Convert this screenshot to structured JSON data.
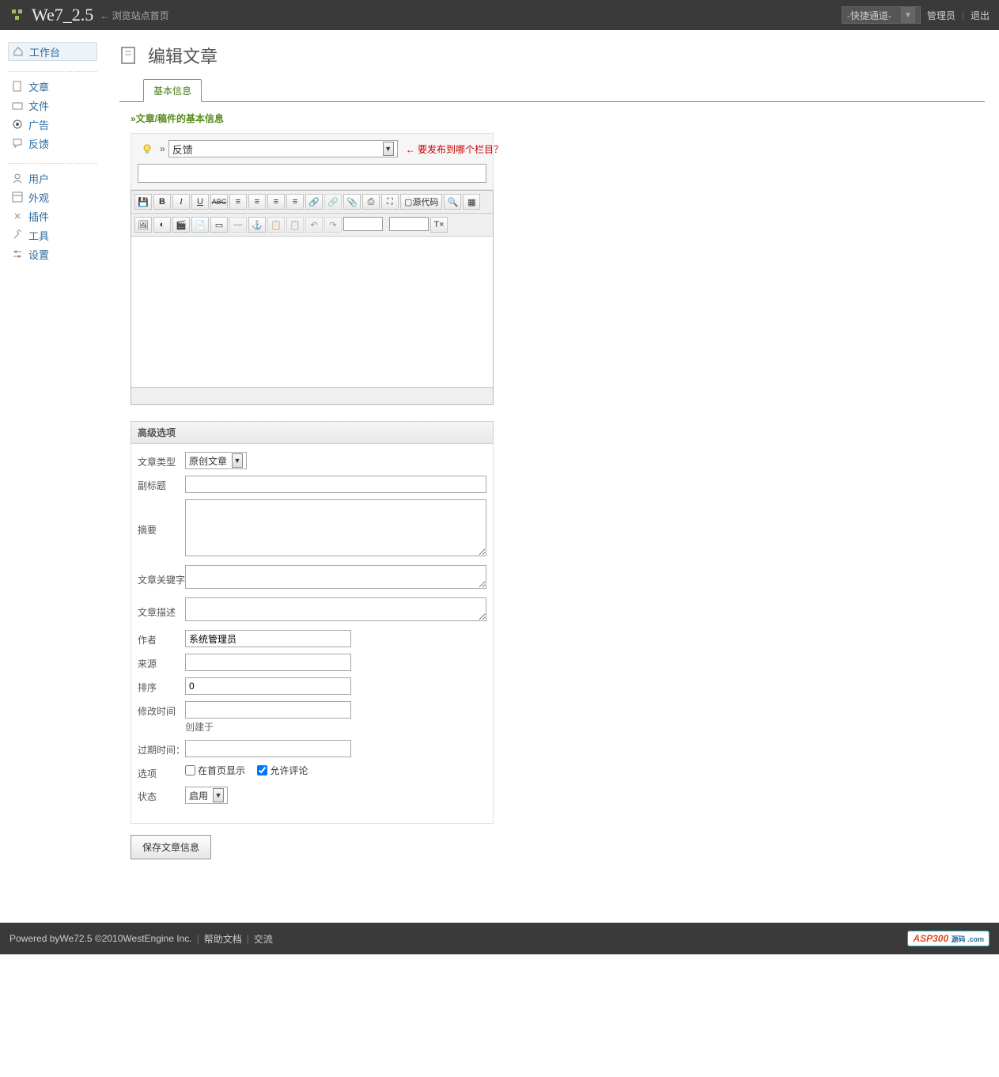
{
  "topbar": {
    "brand": "We7_2.5",
    "brand_sub": "← 浏览站点首页",
    "quick_nav": "-快捷通道-",
    "admin_link": "管理员",
    "logout_link": "退出"
  },
  "sidebar": {
    "workbench": "工作台",
    "article": "文章",
    "file": "文件",
    "ad": "广告",
    "feedback": "反馈",
    "user": "用户",
    "appearance": "外观",
    "plugin": "插件",
    "tool": "工具",
    "setting": "设置"
  },
  "page": {
    "title": "编辑文章",
    "tab_basic": "基本信息",
    "section_title": "»文章/稿件的基本信息"
  },
  "basic": {
    "category_value": "反馈",
    "category_hint": "← 要发布到哪个栏目？",
    "title_value": ""
  },
  "editor": {
    "source_label": "源代码",
    "row1": {
      "save": "💾",
      "bold": "B",
      "italic": "I",
      "underline": "U",
      "strike": "ABC",
      "align_left": "≡",
      "align_center": "≡",
      "align_right": "≡",
      "align_justify": "≡",
      "link": "🔗",
      "unlink": "🔗",
      "attach": "📎",
      "pagebreak": "⎙",
      "fullscreen": "⛶",
      "preview": "🔍",
      "blocks": "▦"
    },
    "row2": {
      "image": "🖼",
      "flash": "◐",
      "video": "🎬",
      "word": "📄",
      "template": "▭",
      "hr": "—",
      "anchor": "⚓",
      "copy": "📋",
      "paste": "📋",
      "undo": "↶",
      "redo": "↷",
      "clear": "T×"
    }
  },
  "adv": {
    "header": "高级选项",
    "labels": {
      "type": "文章类型",
      "subtitle": "副标题",
      "summary": "摘要",
      "keywords": "文章关键字",
      "description": "文章描述",
      "author": "作者",
      "source": "来源",
      "order": "排序",
      "mtime": "修改时间",
      "expire": "过期时间：",
      "options": "选项",
      "status": "状态"
    },
    "values": {
      "type": "原创文章",
      "subtitle": "",
      "summary": "",
      "keywords": "",
      "description": "",
      "author": "系统管理员",
      "source": "",
      "order": "0",
      "mtime": "",
      "mtime_created": "创建于",
      "expire": "",
      "opt_show_home": "在首页显示",
      "opt_allow_comment": "允许评论",
      "status": "启用"
    },
    "save_btn": "保存文章信息"
  },
  "footer": {
    "powered_pre": "Powered by ",
    "we7": "We7",
    "ver": " 2.5 ©2010 ",
    "company": "WestEngine Inc.",
    "help": "帮助文档",
    "comm": "交流",
    "asp_brand": "ASP300",
    "asp_sub": "源码 .com"
  }
}
